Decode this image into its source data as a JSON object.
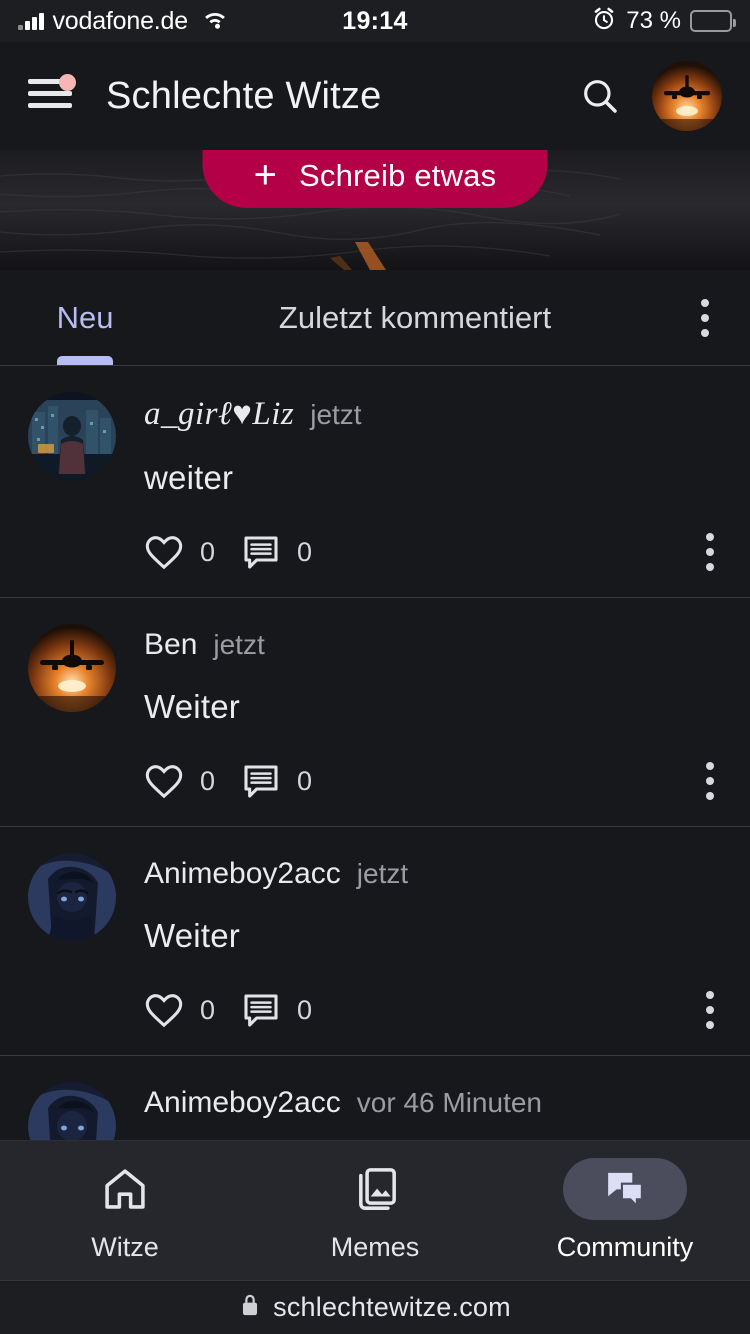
{
  "statusbar": {
    "carrier": "vodafone.de",
    "time": "19:14",
    "battery_percent": "73 %",
    "battery_level": 73,
    "signal_icon": "cellular-signal-icon",
    "wifi_icon": "wifi-icon",
    "alarm_icon": "alarm-clock-icon",
    "battery_icon": "battery-icon",
    "battery_color": "#ffd60a"
  },
  "header": {
    "title": "Schlechte Witze",
    "menu_icon": "hamburger-menu-icon",
    "menu_badge_color": "#f6b6b6",
    "search_icon": "search-icon",
    "avatar_icon": "user-avatar",
    "avatar_alt": "airplane-sunset"
  },
  "banner": {
    "write_button_label": "Schreib etwas",
    "write_button_icon": "plus-icon",
    "write_button_color": "#b40046"
  },
  "tabs": {
    "items": [
      {
        "label": "Neu",
        "active": true
      },
      {
        "label": "Zuletzt kommentiert",
        "active": false
      }
    ],
    "active_color": "#b7bdf2",
    "overflow_icon": "kebab-menu-icon"
  },
  "feed": {
    "like_icon": "heart-icon",
    "comment_icon": "comment-icon",
    "more_icon": "kebab-menu-icon",
    "posts": [
      {
        "username": "a_girℓ♥Liz",
        "time": "jetzt",
        "text": "weiter",
        "likes": "0",
        "comments": "0",
        "avatar_alt": "city-night-silhouette"
      },
      {
        "username": "Ben",
        "time": "jetzt",
        "text": "Weiter",
        "likes": "0",
        "comments": "0",
        "avatar_alt": "airplane-sunset"
      },
      {
        "username": "Animeboy2acc",
        "time": "jetzt",
        "text": "Weiter",
        "likes": "0",
        "comments": "0",
        "avatar_alt": "anime-hooded-boy"
      },
      {
        "username": "Animeboy2acc",
        "time": "vor 46 Minuten",
        "text": "",
        "likes": "",
        "comments": "",
        "avatar_alt": "anime-hooded-boy"
      }
    ]
  },
  "bottomnav": {
    "items": [
      {
        "label": "Witze",
        "icon": "home-icon",
        "active": false
      },
      {
        "label": "Memes",
        "icon": "images-icon",
        "active": false
      },
      {
        "label": "Community",
        "icon": "chat-bubbles-icon",
        "active": true
      }
    ],
    "active_pill_color": "#4b4c5c"
  },
  "urlbar": {
    "url": "schlechtewitze.com",
    "lock_icon": "lock-icon"
  }
}
